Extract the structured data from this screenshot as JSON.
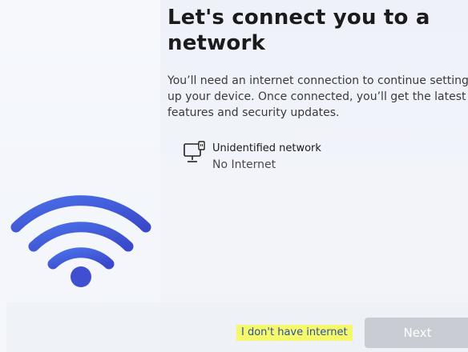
{
  "page": {
    "title": "Let's connect you to a network",
    "description": "You’ll need an internet connection to continue setting up your device. Once connected, you’ll get the latest features and security updates."
  },
  "network": {
    "name": "Unidentified network",
    "status": "No Internet",
    "icon": "wired-network-icon"
  },
  "illustration": {
    "icon": "wifi-icon"
  },
  "actions": {
    "no_internet_label": "I don't have internet",
    "next_label": "Next",
    "next_enabled": false
  },
  "colors": {
    "wifi_blue": "#3f5fde",
    "link_highlight": "#f4f86a",
    "link_text": "#2d4fa8",
    "button_disabled": "#c9ccd2"
  }
}
